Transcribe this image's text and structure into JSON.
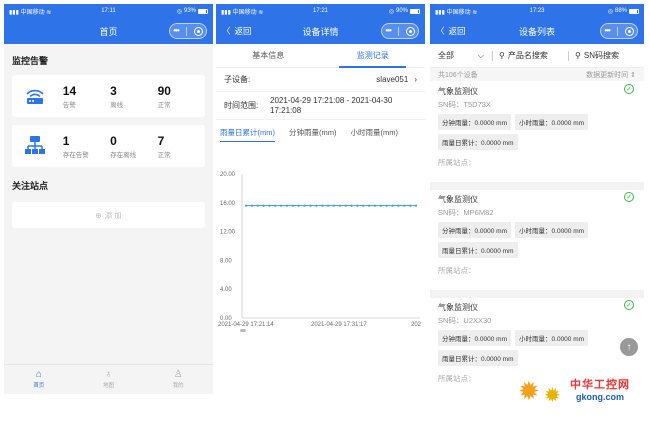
{
  "colors": {
    "primary": "#2f73e8",
    "ok": "#3ab54a",
    "chart_line": "#3a9ad9"
  },
  "screen1": {
    "status": {
      "carrier": "中国移动",
      "time": "17:11",
      "battery": "93%",
      "battery_level": 0.93
    },
    "title": "首页",
    "alert_section": "监控告警",
    "alert_card": {
      "icon": "router-icon",
      "stats": [
        {
          "value": "14",
          "label": "告警"
        },
        {
          "value": "3",
          "label": "离线"
        },
        {
          "value": "90",
          "label": "正常"
        }
      ]
    },
    "network_card": {
      "icon": "network-icon",
      "stats": [
        {
          "value": "1",
          "label": "存在告警"
        },
        {
          "value": "0",
          "label": "存在离线"
        },
        {
          "value": "7",
          "label": "正常"
        }
      ]
    },
    "focus_section": "关注站点",
    "add_label": "添 加",
    "tabbar": [
      {
        "label": "首页",
        "icon": "home-icon"
      },
      {
        "label": "地图",
        "icon": "map-icon"
      },
      {
        "label": "我的",
        "icon": "user-icon"
      }
    ]
  },
  "screen2": {
    "status": {
      "carrier": "中国移动",
      "time": "17:21",
      "battery": "90%",
      "battery_level": 0.9
    },
    "back": "返回",
    "title": "设备详情",
    "tabs": [
      "基本信息",
      "监测记录"
    ],
    "subdevice_label": "子设备:",
    "subdevice_value": "slave051",
    "timerange_label": "时间范围:",
    "timerange_value": "2021-04-29 17:21:08 - 2021-04-30 17:21:08",
    "metric_tabs": [
      "雨量日累计(mm)",
      "分钟雨量(mm)",
      "小时雨量(mm)"
    ]
  },
  "chart_data": {
    "type": "line",
    "title": "",
    "xlabel": "",
    "ylabel": "",
    "ylim": [
      0,
      20
    ],
    "yticks": [
      "0.00",
      "4.00",
      "8.00",
      "12.00",
      "16.00",
      "20.00"
    ],
    "xticks": [
      "2021-04-29 17:21:14",
      "2021-04-29 17:31:17",
      "202"
    ],
    "series": [
      {
        "values": [
          15.6,
          15.6,
          15.6,
          15.6,
          15.6,
          15.6,
          15.6,
          15.6,
          15.6,
          15.6,
          15.6,
          15.6,
          15.6,
          15.6,
          15.6,
          15.6,
          15.6,
          15.6,
          15.6,
          15.6,
          15.6,
          15.6,
          15.6,
          15.6,
          15.6,
          15.6,
          15.6,
          15.6,
          15.6,
          15.6
        ]
      }
    ],
    "grid": false
  },
  "screen3": {
    "status": {
      "carrier": "中国移动",
      "time": "17:23",
      "battery": "88%",
      "battery_level": 0.88
    },
    "back": "返回",
    "title": "设备列表",
    "filter_all": "全部",
    "filter_product": "产品名搜索",
    "filter_sn": "SN码搜索",
    "count": "共106个设备",
    "sort": "数据更新时间",
    "devices": [
      {
        "name": "气象监测仪",
        "sn": "SN码：T5D73X",
        "tags": [
          "分钟雨量：0.0000 mm",
          "小时雨量：0.0000 mm",
          "雨量日累计：0.0000 mm"
        ],
        "site": "所属站点："
      },
      {
        "name": "气象监测仪",
        "sn": "SN码：MP6M82",
        "tags": [
          "分钟雨量：0.0000 mm",
          "小时雨量：0.0000 mm",
          "雨量日累计：0.0000 mm"
        ],
        "site": "所属站点："
      },
      {
        "name": "气象监测仪",
        "sn": "SN码：U2XX30",
        "tags": [
          "分钟雨量：0.0000 mm",
          "小时雨量：0.0000 mm",
          "雨量日累计：0.0000 mm"
        ],
        "site": "所属站点："
      }
    ]
  },
  "watermark": {
    "cn": "中华工控网",
    "url": "gkong.com"
  }
}
